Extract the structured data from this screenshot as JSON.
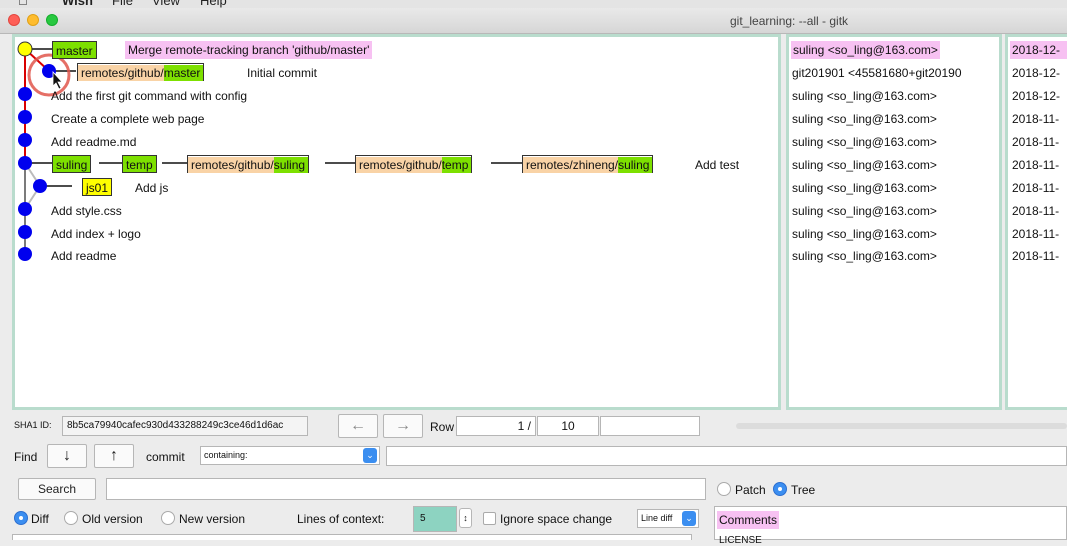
{
  "menubar": {
    "apple": "",
    "app": "Wish",
    "file": "File",
    "view": "View",
    "help": "Help"
  },
  "window": {
    "title": "git_learning: --all - gitk"
  },
  "commits": [
    {
      "msg": "Merge remote-tracking branch 'github/master'",
      "refs": [
        "master"
      ],
      "author": "suling <so_ling@163.com>",
      "date": "2018-12-"
    },
    {
      "msg": "Initial commit",
      "refs": [
        "remotes/github/master"
      ],
      "author": "git201901 <45581680+git20190",
      "date": "2018-12-"
    },
    {
      "msg": "Add the first git command with config",
      "refs": [],
      "author": "suling <so_ling@163.com>",
      "date": "2018-12-"
    },
    {
      "msg": "Create a complete web page",
      "refs": [],
      "author": "suling <so_ling@163.com>",
      "date": "2018-11-"
    },
    {
      "msg": "Add readme.md",
      "refs": [],
      "author": "suling <so_ling@163.com>",
      "date": "2018-11-"
    },
    {
      "msg": "Add test",
      "refs": [
        "suling",
        "temp",
        "remotes/github/suling",
        "remotes/github/temp",
        "remotes/zhineng/suling"
      ],
      "author": "suling <so_ling@163.com>",
      "date": "2018-11-"
    },
    {
      "msg": "Add js",
      "refs": [
        "js01"
      ],
      "author": "suling <so_ling@163.com>",
      "date": "2018-11-"
    },
    {
      "msg": "Add style.css",
      "refs": [],
      "author": "suling <so_ling@163.com>",
      "date": "2018-11-"
    },
    {
      "msg": "Add index + logo",
      "refs": [],
      "author": "suling <so_ling@163.com>",
      "date": "2018-11-"
    },
    {
      "msg": "Add readme",
      "refs": [],
      "author": "suling <so_ling@163.com>",
      "date": "2018-11-"
    }
  ],
  "refparts": {
    "remotes": "remotes/",
    "github": "github/",
    "zhineng": "zhineng/",
    "master": "master",
    "suling": "suling",
    "temp": "temp",
    "js01": "js01"
  },
  "controls": {
    "sha_label": "SHA1 ID:",
    "sha_value": "8b5ca79940cafec930d433288249c3ce46d1d6ac",
    "back_arrow": "←",
    "fwd_arrow": "→",
    "row_label": "Row",
    "row_current": "1 /",
    "row_total": "10",
    "find_label": "Find",
    "down_arrow": "↓",
    "up_arrow": "↑",
    "commit_label": "commit",
    "containing": "containing:",
    "search_label": "Search",
    "patch_label": "Patch",
    "tree_label": "Tree",
    "diff_label": "Diff",
    "old_version_label": "Old version",
    "new_version_label": "New version",
    "lines_context_label": "Lines of context:",
    "lines_context_value": "5",
    "ignore_space_label": "Ignore space change",
    "line_diff_label": "Line diff",
    "comments_label": "Comments",
    "license_text": "LICENSE"
  },
  "colors": {
    "graph_line": "#d90000",
    "node": "#0000ee",
    "selected_node": "#ffff00",
    "pane_border": "#b9dccd",
    "highlight_circle": "#e0564b"
  }
}
